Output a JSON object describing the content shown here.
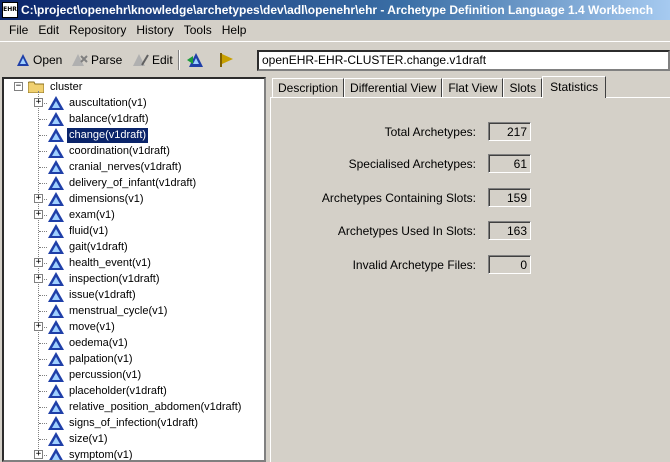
{
  "window": {
    "title": "C:\\project\\openehr\\knowledge\\archetypes\\dev\\adl\\openehr\\ehr - Archetype Definition Language 1.4 Workbench",
    "icon_text": "EHR"
  },
  "menu": [
    "File",
    "Edit",
    "Repository",
    "History",
    "Tools",
    "Help"
  ],
  "toolbar": {
    "open_label": "Open",
    "parse_label": "Parse",
    "edit_label": "Edit",
    "path_value": "openEHR-EHR-CLUSTER.change.v1draft"
  },
  "tree": {
    "root": "cluster",
    "items": [
      {
        "label": "auscultation(v1)",
        "expandable": true
      },
      {
        "label": "balance(v1draft)",
        "expandable": false
      },
      {
        "label": "change(v1draft)",
        "expandable": false,
        "selected": true
      },
      {
        "label": "coordination(v1draft)",
        "expandable": false
      },
      {
        "label": "cranial_nerves(v1draft)",
        "expandable": false
      },
      {
        "label": "delivery_of_infant(v1draft)",
        "expandable": false
      },
      {
        "label": "dimensions(v1)",
        "expandable": true
      },
      {
        "label": "exam(v1)",
        "expandable": true
      },
      {
        "label": "fluid(v1)",
        "expandable": false
      },
      {
        "label": "gait(v1draft)",
        "expandable": false
      },
      {
        "label": "health_event(v1)",
        "expandable": true
      },
      {
        "label": "inspection(v1draft)",
        "expandable": true
      },
      {
        "label": "issue(v1draft)",
        "expandable": false
      },
      {
        "label": "menstrual_cycle(v1)",
        "expandable": false
      },
      {
        "label": "move(v1)",
        "expandable": true
      },
      {
        "label": "oedema(v1)",
        "expandable": false
      },
      {
        "label": "palpation(v1)",
        "expandable": false
      },
      {
        "label": "percussion(v1)",
        "expandable": false
      },
      {
        "label": "placeholder(v1draft)",
        "expandable": false
      },
      {
        "label": "relative_position_abdomen(v1draft)",
        "expandable": false
      },
      {
        "label": "signs_of_infection(v1draft)",
        "expandable": false
      },
      {
        "label": "size(v1)",
        "expandable": false
      },
      {
        "label": "symptom(v1)",
        "expandable": true
      }
    ]
  },
  "tabs": [
    {
      "label": "Description",
      "active": false
    },
    {
      "label": "Differential View",
      "active": false
    },
    {
      "label": "Flat View",
      "active": false
    },
    {
      "label": "Slots",
      "active": false
    },
    {
      "label": "Statistics",
      "active": true
    }
  ],
  "statistics": [
    {
      "label": "Total Archetypes:",
      "value": "217"
    },
    {
      "label": "Specialised Archetypes:",
      "value": "61"
    },
    {
      "label": "Archetypes Containing Slots:",
      "value": "159"
    },
    {
      "label": "Archetypes Used In Slots:",
      "value": "163"
    },
    {
      "label": "Invalid Archetype Files:",
      "value": "0"
    }
  ],
  "colors": {
    "selection": "#0a246a",
    "archetype_icon": "#1f3fa8",
    "folder": "#f0d070",
    "flag_icon": "#c8a000"
  }
}
